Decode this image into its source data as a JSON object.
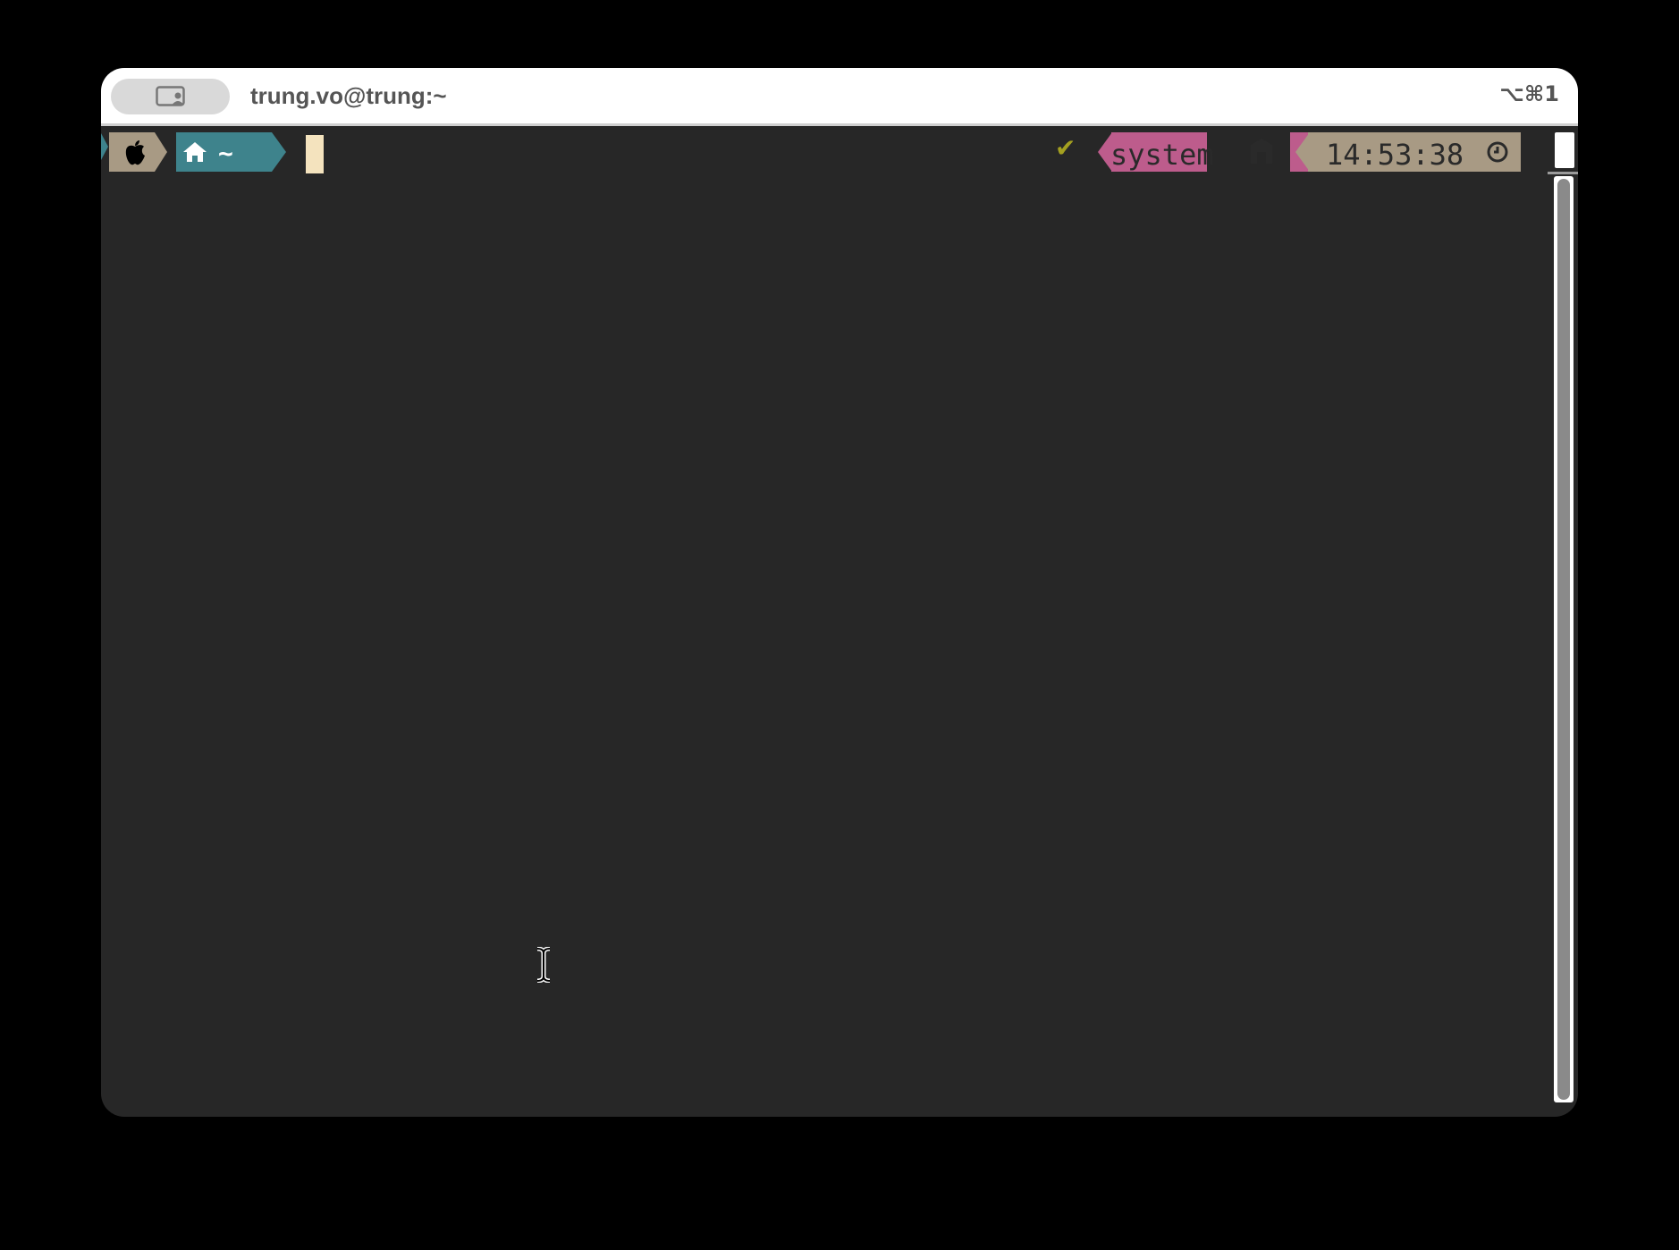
{
  "window": {
    "title": "trung.vo@trung:~",
    "shortcut": "⌥⌘1",
    "tab_icon": "profile-window-icon"
  },
  "prompt": {
    "left": {
      "os_icon": "apple-icon",
      "home_icon": "home-icon",
      "directory": "~"
    },
    "right": {
      "status_mark": "✔",
      "environment": "system",
      "environment_icon": "node-icon",
      "time": "14:53:38",
      "clock_icon": "clock-icon"
    }
  },
  "colors": {
    "terminal_bg": "#272727",
    "os_segment": "#a89a84",
    "dir_segment": "#3e838c",
    "env_segment": "#bd5c8c",
    "time_segment": "#a89a84",
    "cursor": "#f4e3be",
    "status_ok": "#a4a020"
  }
}
